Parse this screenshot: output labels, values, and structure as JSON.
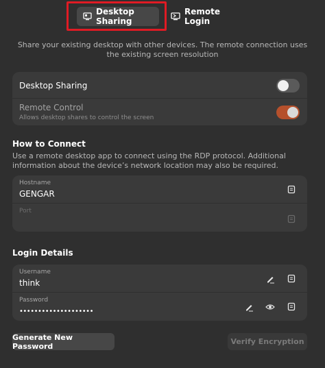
{
  "tabs": [
    {
      "label": "Desktop Sharing",
      "icon": "desktop-sharing-icon",
      "active": true
    },
    {
      "label": "Remote Login",
      "icon": "remote-login-icon",
      "active": false
    }
  ],
  "description": "Share your existing desktop with other devices. The remote connection uses the existing screen resolution",
  "sharing": {
    "desktop_sharing": {
      "label": "Desktop Sharing",
      "enabled": false
    },
    "remote_control": {
      "label": "Remote Control",
      "subtitle": "Allows desktop shares to control the screen",
      "enabled": true,
      "sensitive": false
    }
  },
  "how_to_connect": {
    "title": "How to Connect",
    "description": "Use a remote desktop app to connect using the RDP protocol. Additional information about the device’s network location may also be required.",
    "hostname": {
      "label": "Hostname",
      "value": "GENGAR"
    },
    "port": {
      "label": "Port",
      "value": ""
    }
  },
  "login_details": {
    "title": "Login Details",
    "username": {
      "label": "Username",
      "value": "think"
    },
    "password": {
      "label": "Password",
      "value": "••••••••••••••••••••"
    }
  },
  "buttons": {
    "generate": "Generate New Password",
    "verify": "Verify Encryption"
  },
  "colors": {
    "background": "#2f2f2f",
    "card": "#3a3a3a",
    "accent_switch": "#b5502c",
    "highlight": "#e01b24"
  }
}
